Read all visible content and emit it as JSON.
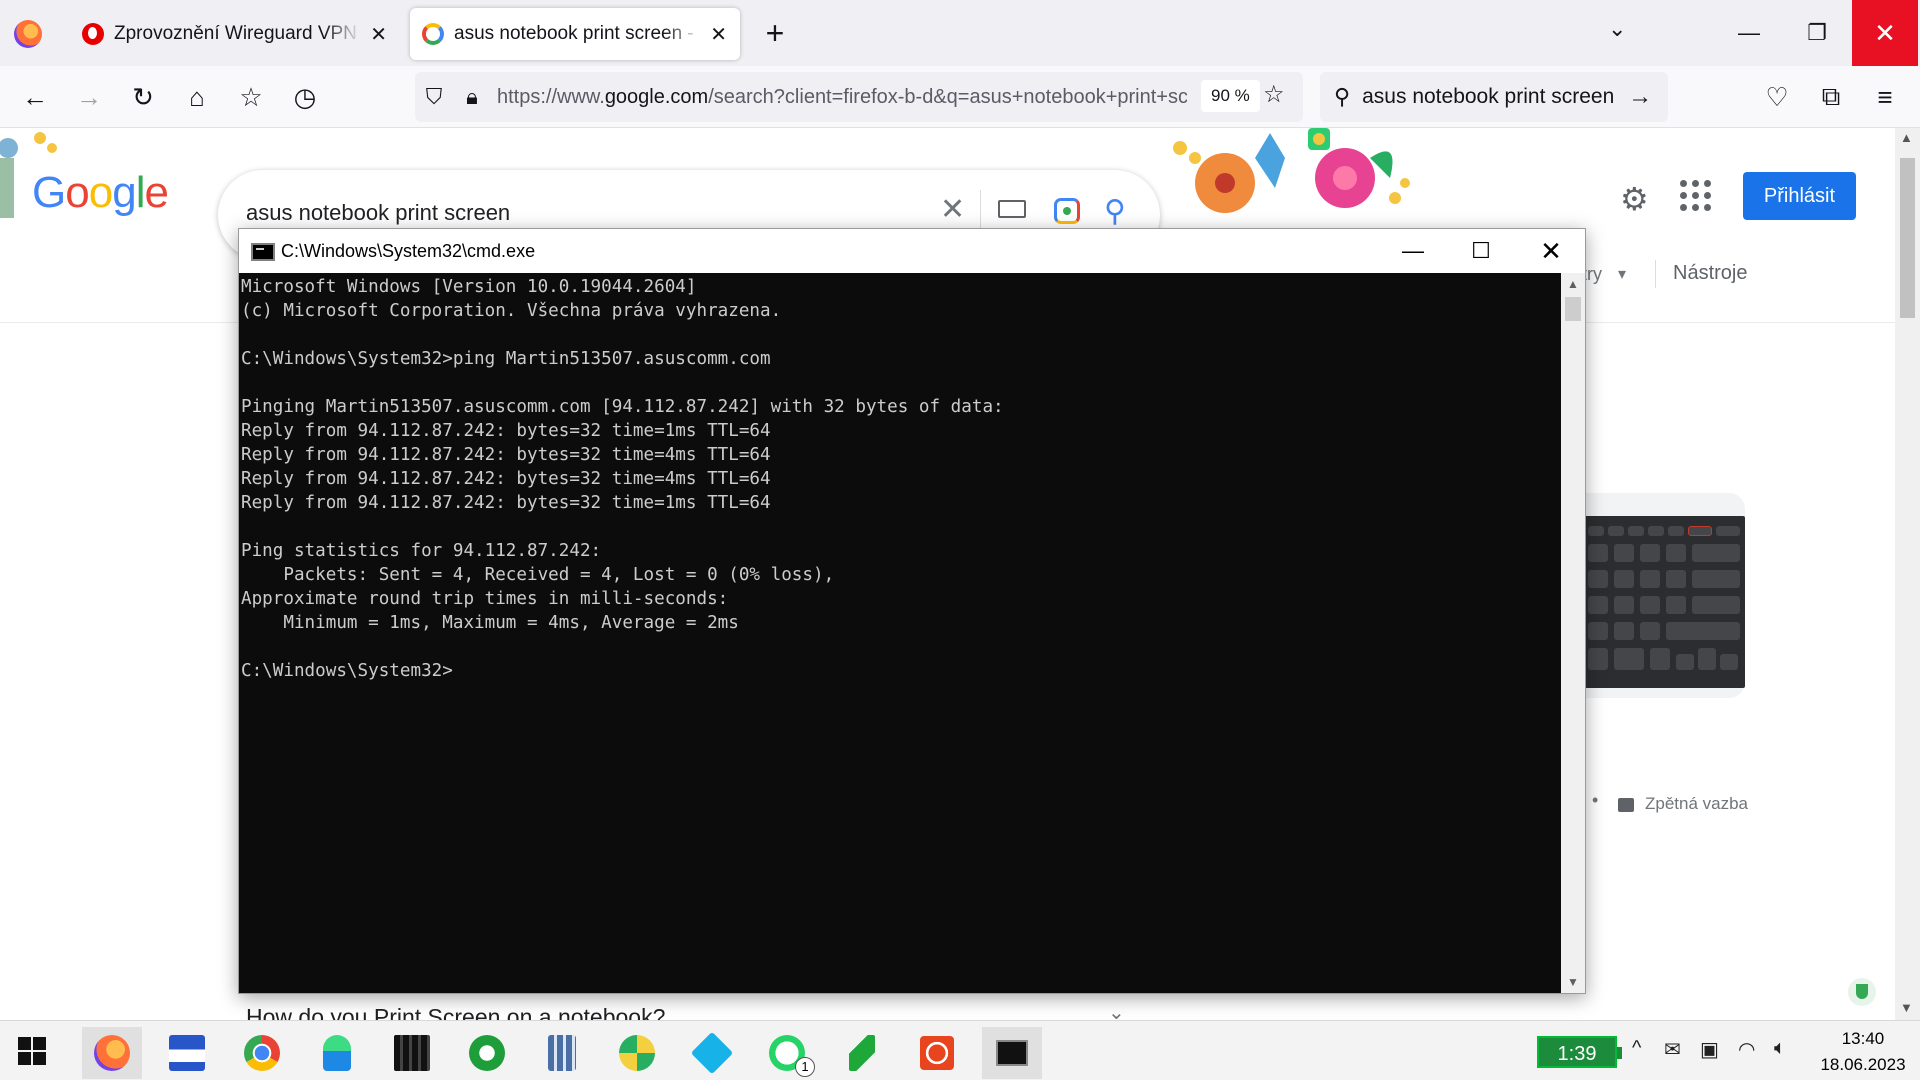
{
  "browser": {
    "tabs": [
      {
        "title": "Zprovoznění Wireguard VPN na",
        "favicon": "vodafone-icon"
      },
      {
        "title": "asus notebook print screen - Hledat",
        "favicon": "google-icon"
      }
    ],
    "url": {
      "prefix": "https://www.",
      "domain": "google.com",
      "rest": "/search?client=firefox-b-d&q=asus+notebook+print+screen"
    },
    "zoom": "90 %",
    "search_box": "asus notebook print screen"
  },
  "google": {
    "query": "asus notebook print screen",
    "signin_label": "Přihlásit",
    "filters_label": "try",
    "tools_label": "Nástroje",
    "feedback_label": "Zpětná vazba",
    "paa_question": "How do you Print Screen on a notebook?",
    "colors": {
      "blue": "#4285f4",
      "red": "#ea4335",
      "yellow": "#fbbc05",
      "green": "#34a853",
      "signin": "#1a73e8"
    }
  },
  "cmd": {
    "title": "C:\\Windows\\System32\\cmd.exe",
    "lines": [
      "Microsoft Windows [Version 10.0.19044.2604]",
      "(c) Microsoft Corporation. Všechna práva vyhrazena.",
      "",
      "C:\\Windows\\System32>ping Martin513507.asuscomm.com",
      "",
      "Pinging Martin513507.asuscomm.com [94.112.87.242] with 32 bytes of data:",
      "Reply from 94.112.87.242: bytes=32 time=1ms TTL=64",
      "Reply from 94.112.87.242: bytes=32 time=4ms TTL=64",
      "Reply from 94.112.87.242: bytes=32 time=4ms TTL=64",
      "Reply from 94.112.87.242: bytes=32 time=1ms TTL=64",
      "",
      "Ping statistics for 94.112.87.242:",
      "    Packets: Sent = 4, Received = 4, Lost = 0 (0% loss),",
      "Approximate round trip times in milli-seconds:",
      "    Minimum = 1ms, Maximum = 4ms, Average = 2ms",
      "",
      "C:\\Windows\\System32>"
    ]
  },
  "taskbar": {
    "apps": [
      "firefox-icon",
      "save-disk-icon",
      "chrome-icon",
      "android-file-icon",
      "video-editor-icon",
      "utorrent-icon",
      "calculator-icon",
      "xmind-icon",
      "kodi-icon",
      "whatsapp-icon",
      "green-arrow-icon",
      "power-icon",
      "cmd-icon"
    ],
    "whatsapp_badge": "1",
    "timer": "1:39",
    "time": "13:40",
    "date": "18.06.2023"
  }
}
